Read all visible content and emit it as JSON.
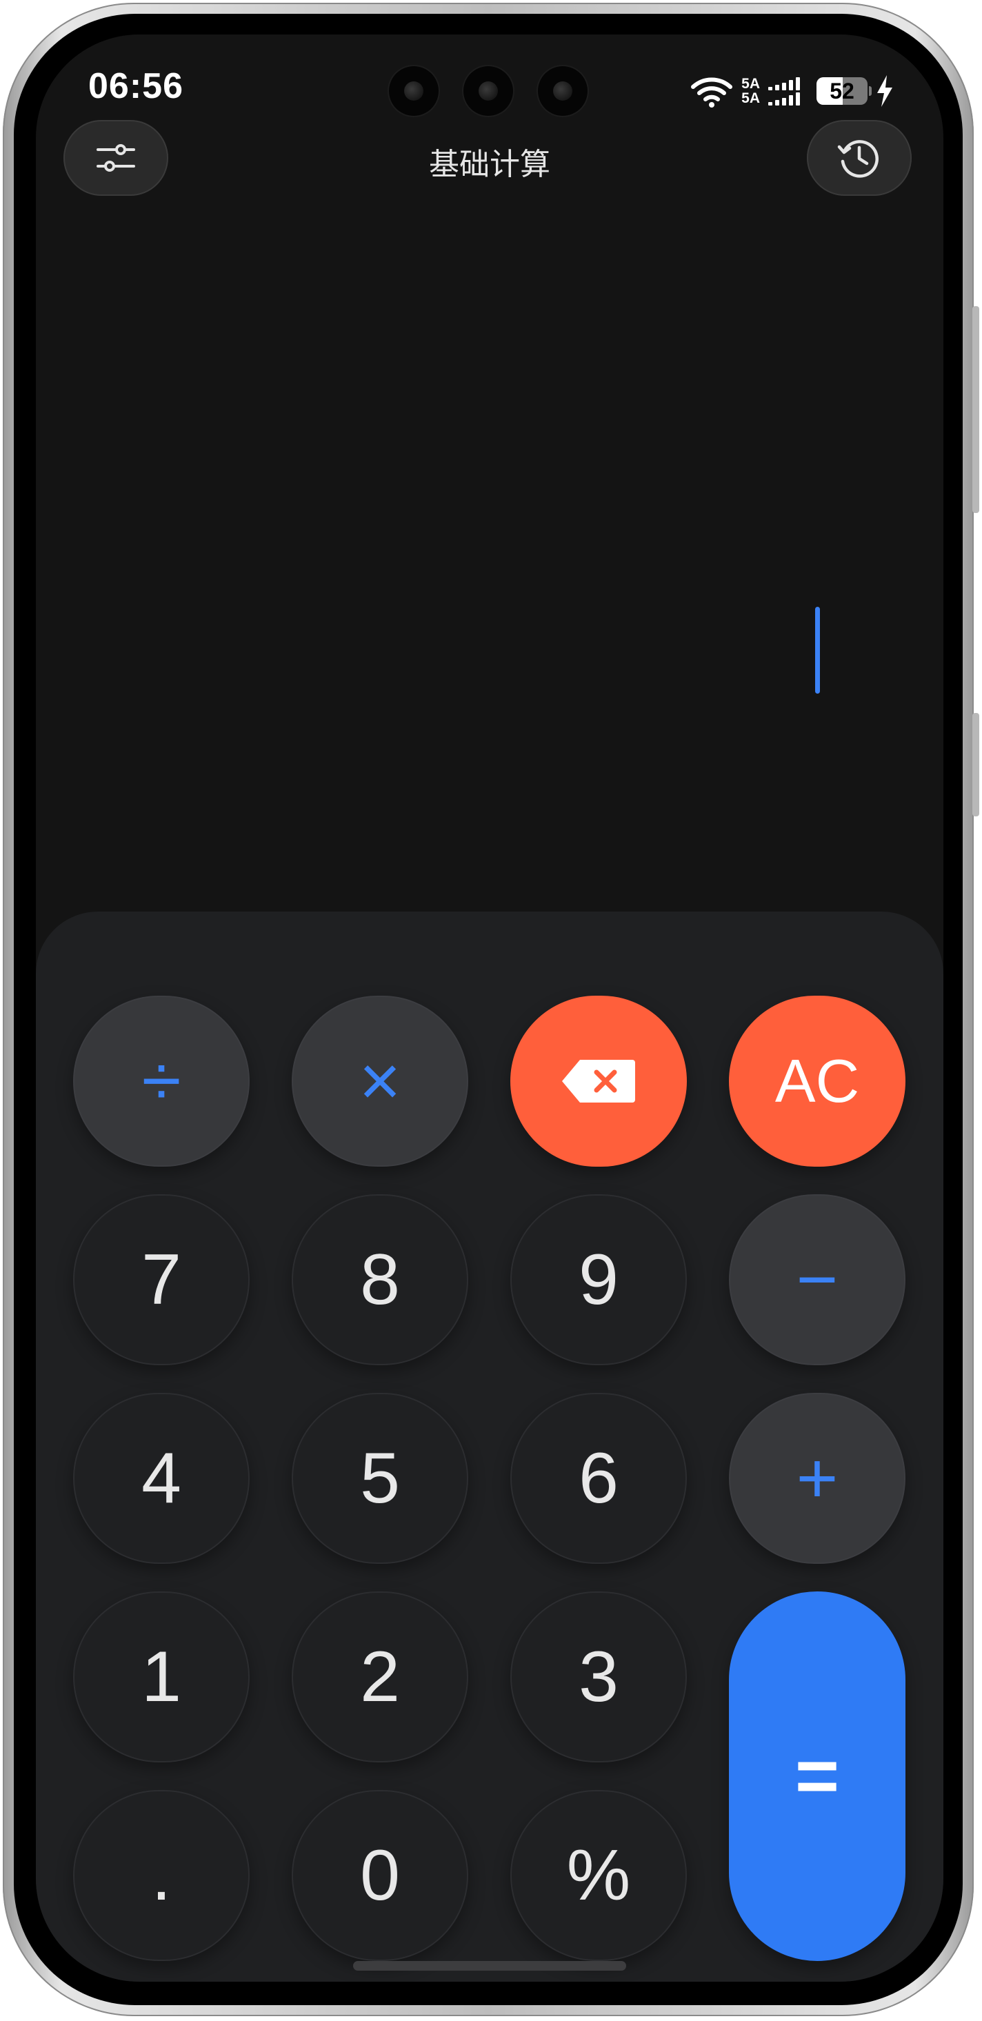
{
  "status_bar": {
    "time": "06:56",
    "network_top": "5A",
    "network_bottom": "5A",
    "battery": "52",
    "battery_level_percent": 52,
    "charging": true,
    "icons": [
      "wifi-icon",
      "signal-icon",
      "battery-icon",
      "charging-icon"
    ]
  },
  "header": {
    "title": "基础计算",
    "left_icon": "settings-sliders-icon",
    "right_icon": "history-icon"
  },
  "display": {
    "expression": "",
    "cursor_color": "#3b82f6"
  },
  "keypad": {
    "divide": "÷",
    "multiply": "×",
    "backspace_icon": "backspace-icon",
    "clear": "AC",
    "k7": "7",
    "k8": "8",
    "k9": "9",
    "minus": "−",
    "k4": "4",
    "k5": "5",
    "k6": "6",
    "plus": "+",
    "k1": "1",
    "k2": "2",
    "k3": "3",
    "equals": "=",
    "dot": ".",
    "k0": "0",
    "percent": "%"
  },
  "colors": {
    "accent": "#3b82f6",
    "danger": "#ff5f3b",
    "equals": "#2f7bf5",
    "background": "#141414",
    "keypad_bg": "#1f2022"
  }
}
